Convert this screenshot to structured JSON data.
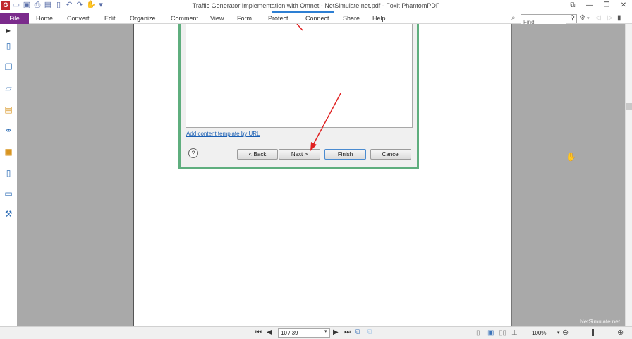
{
  "window": {
    "title": "Traffic Generator Implementation with Omnet - NetSimulate.net.pdf - Foxit PhantomPDF"
  },
  "ribbon": {
    "file_label": "File",
    "tabs": [
      {
        "label": "Home"
      },
      {
        "label": "Convert"
      },
      {
        "label": "Edit"
      },
      {
        "label": "Organize"
      },
      {
        "label": "Comment"
      },
      {
        "label": "View"
      },
      {
        "label": "Form"
      },
      {
        "label": "Protect"
      },
      {
        "label": "Connect"
      },
      {
        "label": "Share"
      },
      {
        "label": "Help"
      }
    ],
    "find_placeholder": "Find"
  },
  "dialog": {
    "link_text": "Add content template by URL",
    "help_icon": "?",
    "back_label": "< Back",
    "next_label": "Next >",
    "finish_label": "Finish",
    "cancel_label": "Cancel",
    "accent_color": "#5fae7e"
  },
  "status": {
    "page_value": "10 / 39",
    "zoom": "100%"
  },
  "watermark": "NetSimulate.net",
  "colors": {
    "file_tab": "#7b2b8c",
    "doc_bg": "#a9a9a9",
    "arrow": "#e02020"
  }
}
